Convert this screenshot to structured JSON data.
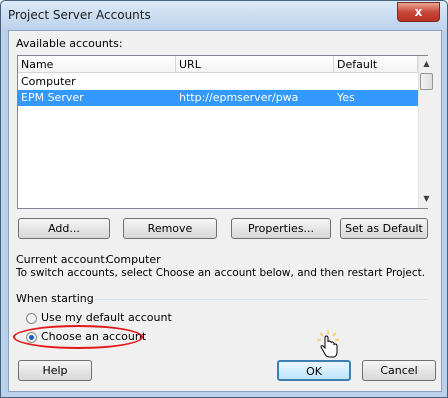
{
  "window": {
    "title": "Project Server Accounts",
    "close_glyph": "x"
  },
  "available_label": "Available accounts:",
  "table": {
    "columns": [
      "Name",
      "URL",
      "Default"
    ],
    "rows": [
      {
        "name": "Computer",
        "url": "",
        "default": ""
      },
      {
        "name": "EPM Server",
        "url": "http://epmserver/pwa",
        "default": "Yes"
      }
    ]
  },
  "buttons": {
    "add": "Add...",
    "remove": "Remove",
    "properties": "Properties...",
    "set_default": "Set as Default",
    "help": "Help",
    "ok": "OK",
    "cancel": "Cancel"
  },
  "current_account": {
    "label": "Current account:",
    "value": "Computer"
  },
  "instruction": "To switch accounts, select Choose an account below, and then restart Project.",
  "when_starting": {
    "label": "When starting",
    "options": [
      "Use my default account",
      "Choose an account"
    ],
    "selected": "Choose an account"
  },
  "colors": {
    "selection": "#3399ff",
    "highlight_ellipse": "#e21717"
  },
  "icons": [
    "close-icon",
    "scroll-up-arrow-icon",
    "scroll-down-arrow-icon",
    "hand-cursor-icon"
  ]
}
